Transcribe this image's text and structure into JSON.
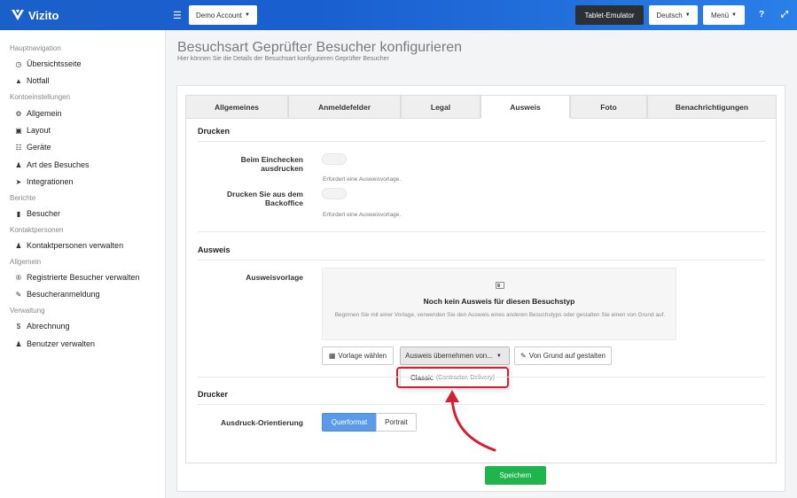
{
  "header": {
    "brand": "Vizito",
    "account": "Demo Account",
    "tablet_emulator": "Tablet-Emulator",
    "language": "Deutsch",
    "menu": "Menü",
    "help_icon": "question-icon",
    "expand_icon": "expand-icon"
  },
  "sidebar": {
    "groups": [
      {
        "heading": "Hauptnavigation",
        "items": [
          {
            "label": "Übersichtsseite",
            "icon": "dashboard-icon"
          },
          {
            "label": "Notfall",
            "icon": "warning-icon"
          }
        ]
      },
      {
        "heading": "Kontoeinstellungen",
        "items": [
          {
            "label": "Allgemein",
            "icon": "gear-icon"
          },
          {
            "label": "Layout",
            "icon": "image-icon"
          },
          {
            "label": "Geräte",
            "icon": "sitemap-icon"
          },
          {
            "label": "Art des Besuches",
            "icon": "users-icon"
          },
          {
            "label": "Integrationen",
            "icon": "plug-icon"
          }
        ]
      },
      {
        "heading": "Berichte",
        "items": [
          {
            "label": "Besucher",
            "icon": "book-icon"
          }
        ]
      },
      {
        "heading": "Kontaktpersonen",
        "items": [
          {
            "label": "Kontaktpersonen verwalten",
            "icon": "person-icon"
          }
        ]
      },
      {
        "heading": "Allgemein",
        "items": [
          {
            "label": "Registrierte Besucher verwalten",
            "icon": "registered-icon"
          },
          {
            "label": "Besucheranmeldung",
            "icon": "pencil-icon"
          }
        ]
      },
      {
        "heading": "Verwaltung",
        "items": [
          {
            "label": "Abrechnung",
            "icon": "dollar-icon"
          },
          {
            "label": "Benutzer verwalten",
            "icon": "user-plus-icon"
          }
        ]
      }
    ]
  },
  "page": {
    "title": "Besuchsart Geprüfter Besucher konfigurieren",
    "subtitle": "Hier können Sie die Details der Besuchsart konfigurieren Geprüfter Besucher"
  },
  "tabs": [
    "Allgemeines",
    "Anmeldefelder",
    "Legal",
    "Ausweis",
    "Foto",
    "Benachrichtigungen"
  ],
  "active_tab": "Ausweis",
  "drucken": {
    "title": "Drucken",
    "checkin_label": "Beim Einchecken ausdrucken",
    "checkin_help": "Erfordert eine Ausweisvorlage.",
    "backoffice_label": "Drucken Sie aus dem Backoffice",
    "backoffice_help": "Erfordert eine Ausweisvorlage."
  },
  "ausweis": {
    "title": "Ausweis",
    "template_label": "Ausweisvorlage",
    "empty_title": "Noch kein Ausweis für diesen Besuchstyp",
    "empty_text": "Beginnen Sie mit einer Vorlage, verwenden Sie den Ausweis eines anderen Besuchstyps oder gestalten Sie einen von Grund auf.",
    "choose_template": "Vorlage wählen",
    "copy_from": "Ausweis übernehmen von...",
    "design_scratch": "Von Grund auf gestalten",
    "dropdown_option": "Classic",
    "dropdown_option_detail": "(Contractor, Delivery)"
  },
  "drucker": {
    "title": "Drucker",
    "orientation_label": "Ausdruck-Orientierung",
    "landscape": "Querformat",
    "portrait": "Portrait"
  },
  "save": "Speichern",
  "colors": {
    "accent": "#1b5fc9",
    "save": "#1fb54c",
    "selected": "#5b9ae8",
    "highlight": "#d32032"
  }
}
